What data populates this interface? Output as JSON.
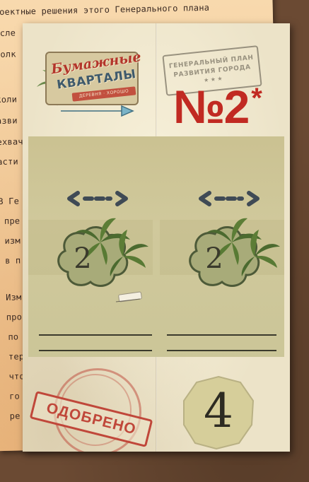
{
  "background_document": {
    "lines": [
      "роектные решения этого Генерального плана",
      "осле",
      "золк",
      "",
      "коли",
      "азви",
      "ехвач",
      "асти",
      "",
      "В Ге",
      "пре",
      "изм",
      "в п",
      "",
      "Изм",
      "про",
      "по",
      "тер",
      "что",
      "го",
      "ре"
    ]
  },
  "card": {
    "logo": {
      "line1": "Бумажные",
      "line2": "КВАРТАЛЫ",
      "ribbon": "ДЕРЕВНЯ · ХОРОШО"
    },
    "plan_stamp": {
      "line1": "ГЕНЕРАЛЬНЫЙ ПЛАН",
      "line2": "РАЗВИТИЯ ГОРОДА",
      "dots": "★ ★ ★"
    },
    "number": "№2",
    "number_star": "*",
    "tiles": [
      {
        "value": "2"
      },
      {
        "value": "2"
      }
    ],
    "approved_stamp": "ОДОБРЕНО",
    "badge_value": "4"
  },
  "colors": {
    "card": "#ece3c8",
    "accent_red": "#c12a22",
    "map_green": "#cfc79a",
    "ink": "#3a3a2c",
    "palm_green": "#556b33"
  }
}
